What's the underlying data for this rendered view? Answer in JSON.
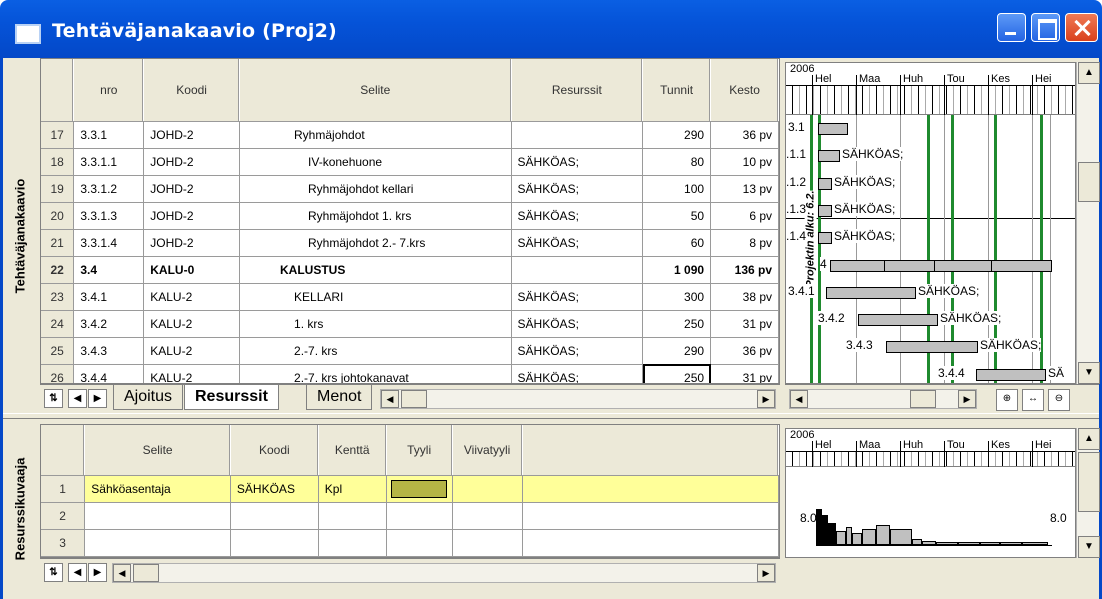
{
  "window": {
    "title": "Tehtäväjanakaavio (Proj2)"
  },
  "top_panel_label": "Tehtäväjanakaavio",
  "bottom_panel_label": "Resurssikuvaaja",
  "task_table": {
    "headers": [
      "nro",
      "Koodi",
      "Selite",
      "Resurssit",
      "Tunnit",
      "Kesto"
    ],
    "rows": [
      {
        "rn": "17",
        "nro": "3.3.1",
        "koodi": "JOHD-2",
        "selite": "Ryhmäjohdot",
        "res": "",
        "tunnit": "290",
        "kesto": "36 pv",
        "indent": 1,
        "bold": false
      },
      {
        "rn": "18",
        "nro": "3.3.1.1",
        "koodi": "JOHD-2",
        "selite": "IV-konehuone",
        "res": "SÄHKÖAS;",
        "tunnit": "80",
        "kesto": "10 pv",
        "indent": 2,
        "bold": false
      },
      {
        "rn": "19",
        "nro": "3.3.1.2",
        "koodi": "JOHD-2",
        "selite": "Ryhmäjohdot kellari",
        "res": "SÄHKÖAS;",
        "tunnit": "100",
        "kesto": "13 pv",
        "indent": 2,
        "bold": false
      },
      {
        "rn": "20",
        "nro": "3.3.1.3",
        "koodi": "JOHD-2",
        "selite": "Ryhmäjohdot 1. krs",
        "res": "SÄHKÖAS;",
        "tunnit": "50",
        "kesto": "6 pv",
        "indent": 2,
        "bold": false
      },
      {
        "rn": "21",
        "nro": "3.3.1.4",
        "koodi": "JOHD-2",
        "selite": "Ryhmäjohdot 2.- 7.krs",
        "res": "SÄHKÖAS;",
        "tunnit": "60",
        "kesto": "8 pv",
        "indent": 2,
        "bold": false
      },
      {
        "rn": "22",
        "nro": "3.4",
        "koodi": "KALU-0",
        "selite": "KALUSTUS",
        "res": "",
        "tunnit": "1 090",
        "kesto": "136 pv",
        "indent": 0,
        "bold": true
      },
      {
        "rn": "23",
        "nro": "3.4.1",
        "koodi": "KALU-2",
        "selite": "KELLARI",
        "res": "SÄHKÖAS;",
        "tunnit": "300",
        "kesto": "38 pv",
        "indent": 1,
        "bold": false
      },
      {
        "rn": "24",
        "nro": "3.4.2",
        "koodi": "KALU-2",
        "selite": "1. krs",
        "res": "SÄHKÖAS;",
        "tunnit": "250",
        "kesto": "31 pv",
        "indent": 1,
        "bold": false
      },
      {
        "rn": "25",
        "nro": "3.4.3",
        "koodi": "KALU-2",
        "selite": "2.-7. krs",
        "res": "SÄHKÖAS;",
        "tunnit": "290",
        "kesto": "36 pv",
        "indent": 1,
        "bold": false
      },
      {
        "rn": "26",
        "nro": "3.4.4",
        "koodi": "KALU-2",
        "selite": "2.-7. krs johtokanavat",
        "res": "SÄHKÖAS;",
        "tunnit": "250",
        "kesto": "31 pv",
        "indent": 1,
        "bold": false
      }
    ]
  },
  "tabs": [
    "Ajoitus",
    "Resurssit",
    "Menot"
  ],
  "active_tab": "Resurssit",
  "gantt": {
    "year": "2006",
    "months": [
      "Hel",
      "Maa",
      "Huh",
      "Tou",
      "Kes",
      "Hei"
    ],
    "milestone_label": "Projektin alku: 6.2.",
    "bar_labels": [
      "3.1",
      ".1.1",
      ".1.2",
      ".1.3",
      ".1.4",
      "4",
      "3.4.1",
      "3.4.2",
      "3.4.3",
      "3.4.4"
    ],
    "resource_label": "SÄHKÖAS;",
    "resource_label_cut": "SÄ"
  },
  "resource_table": {
    "headers": [
      "Selite",
      "Koodi",
      "Kenttä",
      "Tyyli",
      "Viivatyyli"
    ],
    "rows": [
      {
        "rn": "1",
        "selite": "Sähköasentaja",
        "koodi": "SÄHKÖAS",
        "kentta": "Kpl"
      },
      {
        "rn": "2",
        "selite": "",
        "koodi": "",
        "kentta": ""
      },
      {
        "rn": "3",
        "selite": "",
        "koodi": "",
        "kentta": ""
      }
    ],
    "style_color": "#b5b545",
    "highlight_color": "#ffff99"
  },
  "resource_chart": {
    "year": "2006",
    "months": [
      "Hel",
      "Maa",
      "Huh",
      "Tou",
      "Kes",
      "Hei"
    ],
    "left_value": "8.0",
    "right_value": "8.0"
  }
}
